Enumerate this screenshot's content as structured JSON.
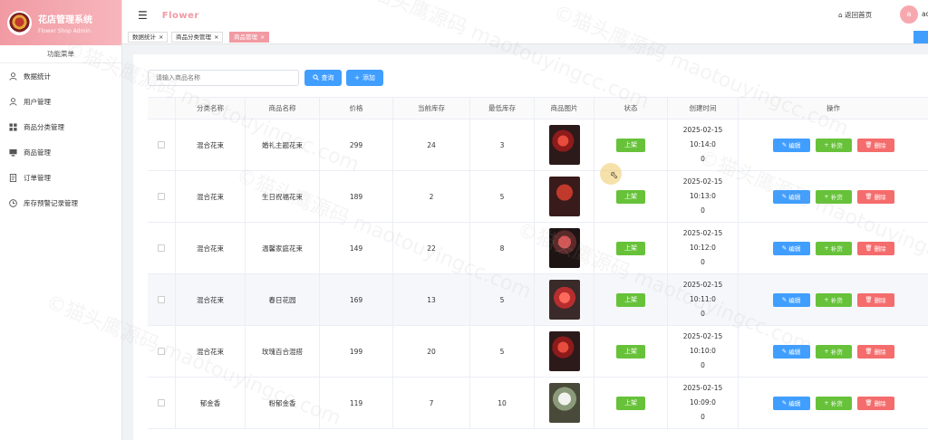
{
  "brand": {
    "title": "花店管理系统",
    "subtitle": "Flower Shop Admin"
  },
  "sidebar": {
    "header": "功能菜单",
    "items": [
      {
        "label": "数据统计",
        "icon": "user-icon"
      },
      {
        "label": "用户管理",
        "icon": "user-icon"
      },
      {
        "label": "商品分类管理",
        "icon": "grid-icon"
      },
      {
        "label": "商品管理",
        "icon": "monitor-icon"
      },
      {
        "label": "订单管理",
        "icon": "document-icon"
      },
      {
        "label": "库存预警记录管理",
        "icon": "clock-icon"
      }
    ]
  },
  "topbar": {
    "title": "Flower",
    "home_label": "返回首页",
    "avatar_letter": "a",
    "username": "ad"
  },
  "tabs": [
    {
      "label": "数据统计",
      "active": false
    },
    {
      "label": "商品分类管理",
      "active": false
    },
    {
      "label": "商品管理",
      "active": true
    }
  ],
  "search": {
    "placeholder": "请输入商品名称",
    "query_label": "查询",
    "add_label": "添加"
  },
  "table": {
    "headers": [
      "分类名称",
      "商品名称",
      "价格",
      "当前库存",
      "最低库存",
      "商品图片",
      "状态",
      "创建时间",
      "操作"
    ],
    "rows": [
      {
        "category": "混合花束",
        "name": "婚礼主题花束",
        "price": "299",
        "stock": "24",
        "min_stock": "3",
        "status": "上架",
        "created_1": "2025-02-15 10:14:0",
        "created_2": "0"
      },
      {
        "category": "混合花束",
        "name": "生日祝福花束",
        "price": "189",
        "stock": "2",
        "min_stock": "5",
        "status": "上架",
        "created_1": "2025-02-15 10:13:0",
        "created_2": "0"
      },
      {
        "category": "混合花束",
        "name": "温馨家庭花束",
        "price": "149",
        "stock": "22",
        "min_stock": "8",
        "status": "上架",
        "created_1": "2025-02-15 10:12:0",
        "created_2": "0"
      },
      {
        "category": "混合花束",
        "name": "春日花园",
        "price": "169",
        "stock": "13",
        "min_stock": "5",
        "status": "上架",
        "created_1": "2025-02-15 10:11:0",
        "created_2": "0"
      },
      {
        "category": "混合花束",
        "name": "玫瑰百合混搭",
        "price": "199",
        "stock": "20",
        "min_stock": "5",
        "status": "上架",
        "created_1": "2025-02-15 10:10:0",
        "created_2": "0"
      },
      {
        "category": "郁金香",
        "name": "粉郁金香",
        "price": "119",
        "stock": "7",
        "min_stock": "10",
        "status": "上架",
        "created_1": "2025-02-15 10:09:0",
        "created_2": "0"
      }
    ],
    "actions": {
      "edit": "编辑",
      "stock": "补货",
      "delete": "删除"
    }
  },
  "watermark": "©猫头鹰源码 maotouyingcc.com",
  "colors": {
    "brand_pink": "#f19aa3",
    "primary": "#409eff",
    "success": "#67c23a",
    "danger": "#f56c6c"
  }
}
